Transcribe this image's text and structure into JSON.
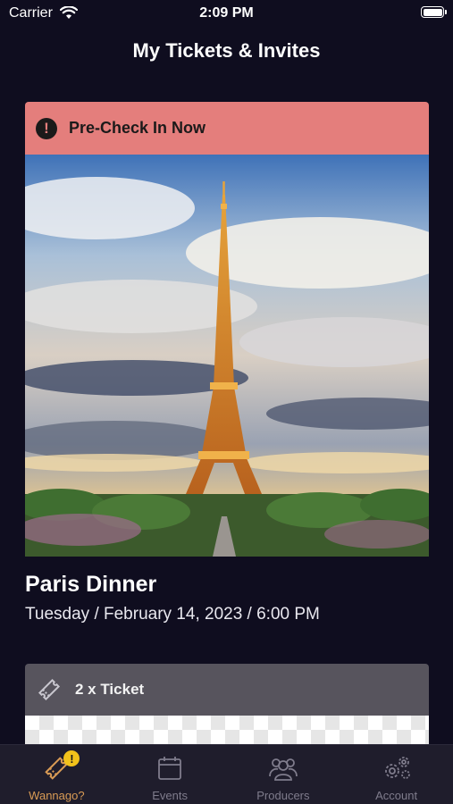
{
  "status_bar": {
    "carrier": "Carrier",
    "time": "2:09 PM"
  },
  "header": {
    "title": "My Tickets & Invites"
  },
  "event": {
    "banner_text": "Pre-Check In Now",
    "banner_icon": "alert-icon",
    "image_alt": "Eiffel Tower",
    "title": "Paris Dinner",
    "date": "Tuesday / February 14, 2023 / 6:00 PM"
  },
  "ticket": {
    "label": "2 x Ticket",
    "icon": "ticket-icon"
  },
  "tabs": [
    {
      "label": "Wannago?",
      "icon": "ticket-icon",
      "badge": "!",
      "active": true
    },
    {
      "label": "Events",
      "icon": "calendar-icon",
      "active": false
    },
    {
      "label": "Producers",
      "icon": "people-icon",
      "active": false
    },
    {
      "label": "Account",
      "icon": "gears-icon",
      "active": false
    }
  ],
  "colors": {
    "background": "#0f0d1f",
    "banner": "#e47e7c",
    "ticket_card": "#57545d",
    "active_tab": "#d99b55",
    "badge": "#f2c21b"
  }
}
